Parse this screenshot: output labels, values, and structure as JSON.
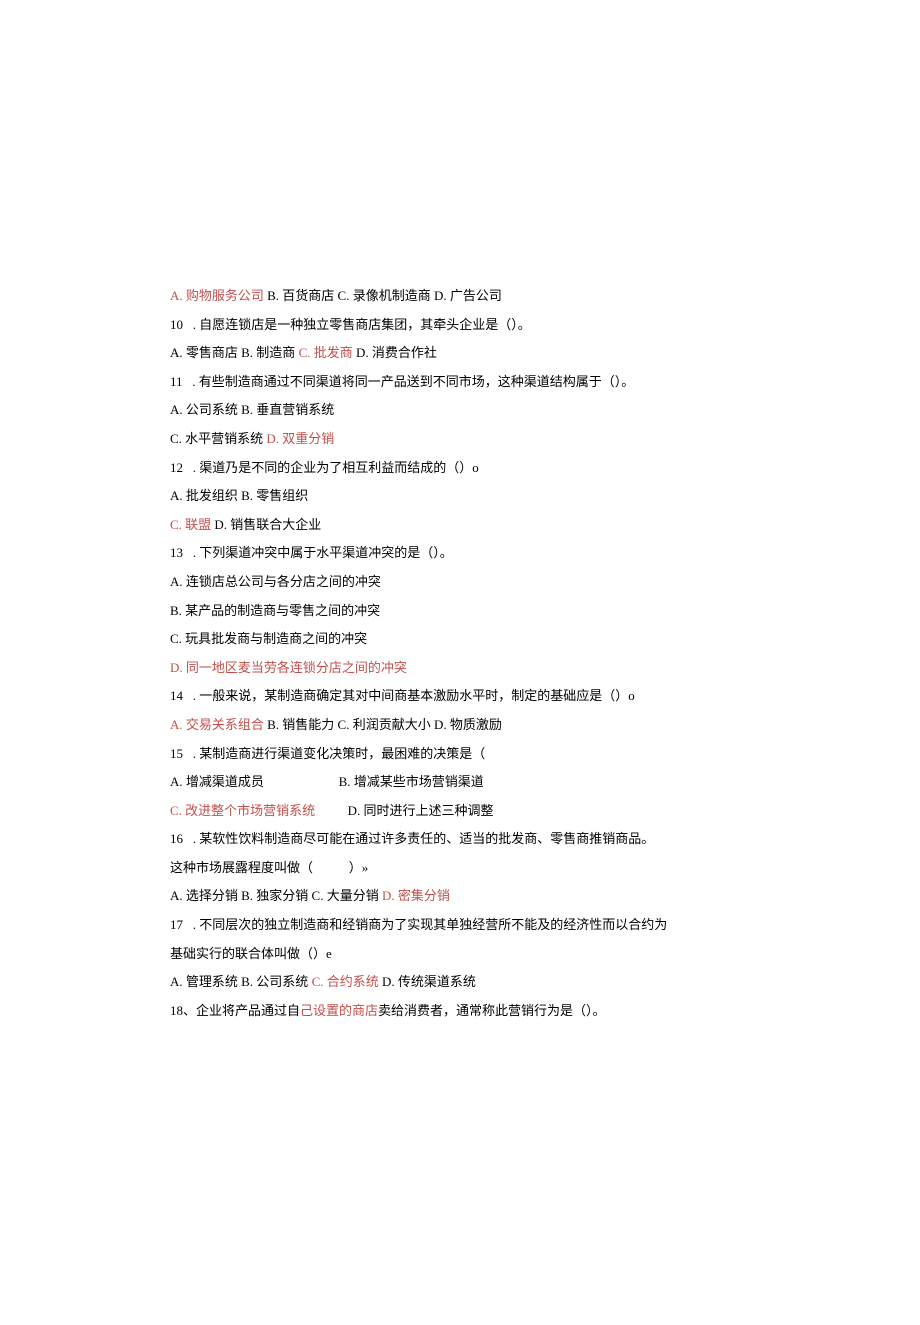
{
  "colors": {
    "answer": "#c0504d",
    "text": "#000000"
  },
  "lines": [
    {
      "segments": [
        {
          "text": "A. 购物服务公司 ",
          "style": "red"
        },
        {
          "text": "B. 百货商店 C. 录像机制造商 D. 广告公司",
          "style": "black"
        }
      ]
    },
    {
      "segments": [
        {
          "text": "10   . 自愿连锁店是一种独立零售商店集团，其牵头企业是（）。",
          "style": "black"
        }
      ]
    },
    {
      "segments": [
        {
          "text": "A. 零售商店 B. 制造商 ",
          "style": "black"
        },
        {
          "text": "C. 批发商 ",
          "style": "red"
        },
        {
          "text": "D. 消费合作社",
          "style": "black"
        }
      ]
    },
    {
      "segments": [
        {
          "text": "11   . 有些制造商通过不同渠道将同一产品送到不同市场，这种渠道结构属于（）。",
          "style": "black"
        }
      ]
    },
    {
      "segments": [
        {
          "text": "A. 公司系统 B. 垂直营销系统",
          "style": "black"
        }
      ]
    },
    {
      "segments": [
        {
          "text": "C. 水平营销系统 ",
          "style": "black"
        },
        {
          "text": "D. 双重分销",
          "style": "red"
        }
      ]
    },
    {
      "segments": [
        {
          "text": "12   . 渠道乃是不同的企业为了相互利益而结成的（）o",
          "style": "black"
        }
      ]
    },
    {
      "segments": [
        {
          "text": "A. 批发组织 B. 零售组织",
          "style": "black"
        }
      ]
    },
    {
      "segments": [
        {
          "text": "C. 联盟 ",
          "style": "red"
        },
        {
          "text": "D. 销售联合大企业",
          "style": "black"
        }
      ]
    },
    {
      "segments": [
        {
          "text": "13   . 下列渠道冲突中属于水平渠道冲突的是（）。",
          "style": "black"
        }
      ]
    },
    {
      "segments": [
        {
          "text": "A. 连锁店总公司与各分店之间的冲突",
          "style": "black"
        }
      ]
    },
    {
      "segments": [
        {
          "text": "B. 某产品的制造商与零售之间的冲突",
          "style": "black"
        }
      ]
    },
    {
      "segments": [
        {
          "text": "C. 玩具批发商与制造商之间的冲突",
          "style": "black"
        }
      ]
    },
    {
      "segments": [
        {
          "text": "D. 同一地区麦当劳各连锁分店之间的冲突",
          "style": "red"
        }
      ]
    },
    {
      "segments": [
        {
          "text": "14   . 一般来说，某制造商确定其对中间商基本激励水平时，制定的基础应是（）o",
          "style": "black"
        }
      ]
    },
    {
      "segments": [
        {
          "text": "A. 交易关系组合 ",
          "style": "red"
        },
        {
          "text": "B. 销售能力 C. 利润贡献大小 D. 物质激励",
          "style": "black"
        }
      ]
    },
    {
      "segments": [
        {
          "text": "15   . 某制造商进行渠道变化决策时，最困难的决策是（",
          "style": "black"
        }
      ]
    },
    {
      "segments": [
        {
          "text": "A. 增减渠道成员                       B. 增减某些市场营销渠道",
          "style": "black"
        }
      ]
    },
    {
      "segments": [
        {
          "text": "C. 改进整个市场营销系统          ",
          "style": "red"
        },
        {
          "text": "D. 同时进行上述三种调整",
          "style": "black"
        }
      ]
    },
    {
      "segments": [
        {
          "text": "16   . 某软性饮料制造商尽可能在通过许多责任的、适当的批发商、零售商推销商品。",
          "style": "black"
        }
      ]
    },
    {
      "segments": [
        {
          "text": "这种市场展露程度叫做（           ）»",
          "style": "black"
        }
      ]
    },
    {
      "segments": [
        {
          "text": "A. 选择分销 B. 独家分销 C. 大量分销 ",
          "style": "black"
        },
        {
          "text": "D. 密集分销",
          "style": "red"
        }
      ]
    },
    {
      "segments": [
        {
          "text": "17   . 不同层次的独立制造商和经销商为了实现其单独经营所不能及的经济性而以合约为",
          "style": "black"
        }
      ]
    },
    {
      "segments": [
        {
          "text": "基础实行的联合体叫做（）e",
          "style": "black"
        }
      ]
    },
    {
      "segments": [
        {
          "text": "A. 管理系统 B. 公司系统 ",
          "style": "black"
        },
        {
          "text": "C. 合约系统 ",
          "style": "red"
        },
        {
          "text": "D. 传统渠道系统",
          "style": "black"
        }
      ]
    },
    {
      "segments": [
        {
          "text": "18、企业将产品通过自",
          "style": "black"
        },
        {
          "text": "己设置的商店",
          "style": "red"
        },
        {
          "text": "卖给消费者，通常称此营销行为是（）。",
          "style": "black"
        }
      ]
    }
  ]
}
